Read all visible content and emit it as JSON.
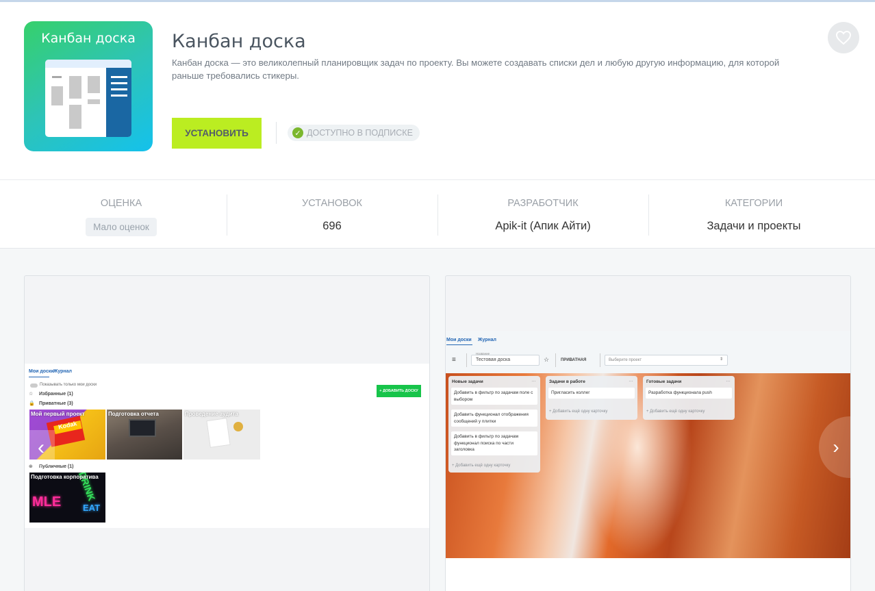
{
  "app": {
    "icon_title": "Канбан доска",
    "title": "Канбан доска",
    "description": "Канбан доска — это великолепный планировщик задач по проекту. Вы можете создавать списки дел и любую другую информацию, для которой раньше требовались стикеры.",
    "install_label": "УСТАНОВИТЬ",
    "subscription_label": "ДОСТУПНО В ПОДПИСКЕ"
  },
  "stats": [
    {
      "label": "ОЦЕНКА",
      "value": "Мало оценок"
    },
    {
      "label": "УСТАНОВОК",
      "value": "696"
    },
    {
      "label": "РАЗРАБОТЧИК",
      "value": "Apik-it (Апик Айти)"
    },
    {
      "label": "КАТЕГОРИИ",
      "value": "Задачи и проекты"
    }
  ],
  "screenshot1": {
    "tabs": [
      "Мои доски",
      "Журнал"
    ],
    "toggle_label": "Показывать только мои доски",
    "add_board": "+ ДОБАВИТЬ ДОСКУ",
    "favorites": "Избранные (1)",
    "private": "Приватные (3)",
    "public": "Публичные (1)",
    "boards": [
      "Мой первый проект",
      "Подготовка отчета",
      "Проведение аудита",
      "Подготовка корпоратива"
    ],
    "kodak": "Kodak"
  },
  "screenshot2": {
    "tabs": [
      "Мои доски",
      "Журнал"
    ],
    "name_label": "Название",
    "board_name": "Тестовая доска",
    "privacy": "ПРИВАТНАЯ",
    "project_placeholder": "Выберите проект",
    "columns": [
      {
        "title": "Новые задачи",
        "cards": [
          "Добавить в фильтр по задачам поле с выбором",
          "Добавить функционал отображения сообщений у плитки",
          "Добавить в фильтр по задачам функционал поиска по части заголовка"
        ]
      },
      {
        "title": "Задачи в работе",
        "cards": [
          "Пригласить коллег"
        ]
      },
      {
        "title": "Готовые задачи",
        "cards": [
          "Разработка функционала push"
        ]
      }
    ],
    "add_card": "Добавить ещё одну карточку"
  },
  "colors": {
    "install": "#bbed21",
    "check": "#7bb72e",
    "title": "#4a5560"
  },
  "icons": [
    "heart-icon",
    "check-icon",
    "chevron-left-icon",
    "chevron-right-icon",
    "star-icon",
    "lock-icon",
    "menu-icon"
  ]
}
